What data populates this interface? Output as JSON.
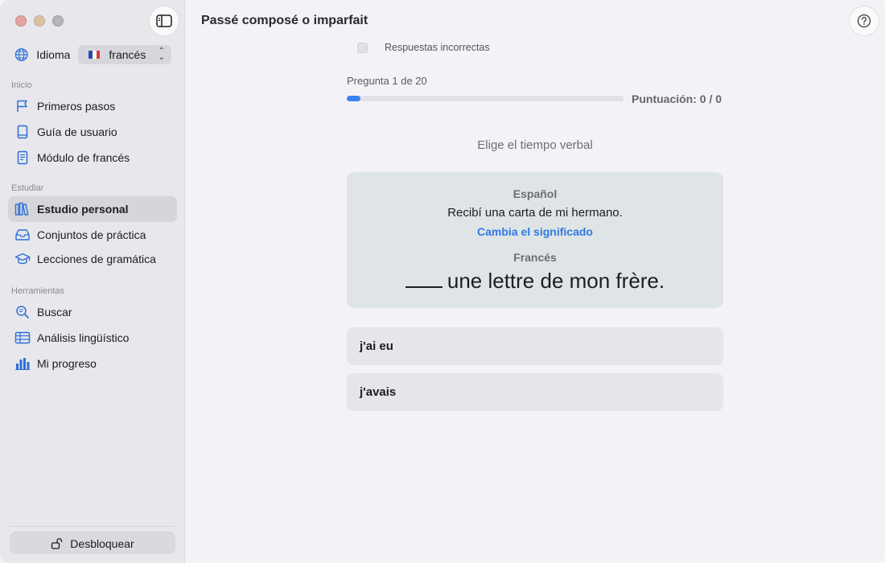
{
  "sidebar": {
    "language_label": "Idioma",
    "language_value": "francés",
    "sections": [
      {
        "title": "Inicio",
        "items": [
          {
            "label": "Primeros pasos",
            "icon": "flag-icon"
          },
          {
            "label": "Guía de usuario",
            "icon": "book-icon"
          },
          {
            "label": "Módulo de francés",
            "icon": "document-icon"
          }
        ]
      },
      {
        "title": "Estudiar",
        "items": [
          {
            "label": "Estudio personal",
            "icon": "books-icon",
            "active": true
          },
          {
            "label": "Conjuntos de práctica",
            "icon": "tray-icon"
          },
          {
            "label": "Lecciones de gramática",
            "icon": "graduation-cap-icon"
          }
        ]
      },
      {
        "title": "Herramientas",
        "items": [
          {
            "label": "Buscar",
            "icon": "search-icon"
          },
          {
            "label": "Análisis lingüístico",
            "icon": "table-icon"
          },
          {
            "label": "Mi progreso",
            "icon": "bar-chart-icon"
          }
        ]
      }
    ],
    "unlock_label": "Desbloquear"
  },
  "main": {
    "title": "Passé composé o imparfait",
    "incorrect_checkbox_label": "Respuestas incorrectas",
    "progress": {
      "label": "Pregunta 1 de 20",
      "fraction": 0.05
    },
    "score": "Puntuación: 0 / 0",
    "instruction": "Elige el tiempo verbal",
    "card": {
      "source_label": "Español",
      "source_sentence": "Recibí una carta de mi hermano.",
      "change_meaning": "Cambia el significado",
      "target_label": "Francés",
      "target_sentence": "une lettre de mon frère."
    },
    "options": [
      "j'ai eu",
      "j'avais"
    ]
  },
  "colors": {
    "accent": "#3a82f0",
    "link": "#2f7ae5",
    "sidebar_icon": "#2f6fd6"
  }
}
